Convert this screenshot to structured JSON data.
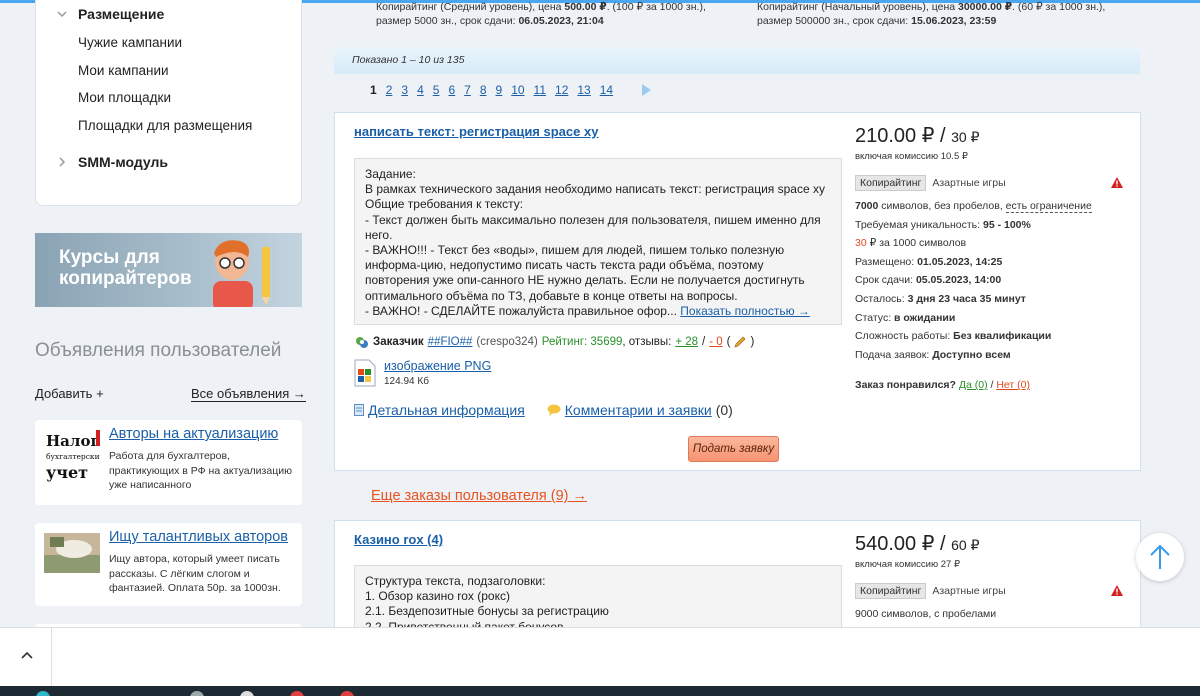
{
  "sidebar": {
    "section_placement": "Размещение",
    "items": [
      "Чужие кампании",
      "Мои кампании",
      "Мои площадки",
      "Площадки для размещения"
    ],
    "section_smm": "SMM-модуль"
  },
  "banner": {
    "text": "Курсы для копирайтеров"
  },
  "ads": {
    "title": "Объявления пользователей",
    "add": "Добавить +",
    "all": "Все объявления →",
    "items": [
      {
        "title": "Авторы на актуализацию",
        "desc": "Работа для бухгалтеров, практикующих в РФ на актуализацию уже написанного",
        "thumb_text": "Налоги бухгалтерский учет"
      },
      {
        "title": "Ищу талантливых авторов",
        "desc": "Ищу автора, который умеет писать рассказы. С лёгким слогом и фантазией. Оплата 50р. за 1000зн."
      }
    ]
  },
  "top_orders": [
    {
      "line1": "Копирайтинг (Средний уровень), цена ",
      "price": "500.00 ₽",
      "rate": ". (100 ₽ за 1000 зн.),",
      "line2": "размер 5000 зн., срок сдачи: ",
      "deadline": "06.05.2023, 21:04"
    },
    {
      "line1": "Копирайтинг (Начальный уровень), цена ",
      "price": "30000.00 ₽",
      "rate": ". (60 ₽ за 1000 зн.),",
      "line2": "размер 500000 зн., срок сдачи: ",
      "deadline": "15.06.2023, 23:59"
    }
  ],
  "shown": "Показано 1 – 10 из 135",
  "pagination": {
    "current": "1",
    "pages": [
      "2",
      "3",
      "4",
      "5",
      "6",
      "7",
      "8",
      "9",
      "10",
      "11",
      "12",
      "13",
      "14"
    ]
  },
  "order1": {
    "title": "написать текст: регистрация space xy",
    "task": "Задание:\nВ рамках технического задания необходимо написать текст: регистрация space xy\nОбщие требования к тексту:\n- Текст должен быть максимально полезен для пользователя, пишем именно для него.\n- ВАЖНО!!! - Текст без «воды», пишем для людей, пишем только полезную информа-цию, недопустимо писать часть текста ради объёма, поэтому повторения уже опи-санного НЕ нужно делать. Если не получается достигнуть оптимального объёма по ТЗ, добавьте в конце ответы на вопросы.\n- ВАЖНО! - СДЕЛАЙТЕ пожалуйста правильное офор...",
    "show_full": "Показать полностью →",
    "price": "210.00 ₽",
    "price_per": "30 ₽",
    "commission": "включая комиссию 10.5 ₽",
    "tag_main": "Копирайтинг",
    "tag_sub": "Азартные игры",
    "chars_value": "7000",
    "chars_text": " символов, без пробелов, ",
    "chars_limit": "есть ограничение",
    "uniqueness_label": "Требуемая уникальность: ",
    "uniqueness_value": "95 - 100%",
    "rate_value": "30",
    "rate_text": " ₽ за 1000 символов",
    "placed_label": "Размещено: ",
    "placed_value": "01.05.2023, 14:25",
    "deadline_label": "Срок сдачи: ",
    "deadline_value": "05.05.2023, 14:00",
    "left_label": "Осталось: ",
    "left_value": "3 дня 23 часа 35 минут",
    "status_label": "Статус: ",
    "status_value": "в ожидании",
    "difficulty_label": "Сложность работы: ",
    "difficulty_value": "Без квалификации",
    "apply_label": "Подача заявок: ",
    "apply_value": "Доступно всем",
    "liked_label": "Заказ понравился?",
    "liked_yes": "Да (0)",
    "liked_no": "Нет (0)",
    "customer_label": "Заказчик",
    "customer_name": "##FIO##",
    "customer_login": "(crespo324)",
    "rating_label": "Рейтинг: 35699",
    "reviews_label": ", отзывы: ",
    "reviews_pos": "+ 28",
    "reviews_neg": "- 0",
    "file_name": "изображение PNG",
    "file_size": "124.94 Кб",
    "details": "Детальная информация",
    "comments": "Комментарии и заявки",
    "comments_count": "(0)",
    "submit": "Подать заявку"
  },
  "more_orders": "Еще заказы пользователя (9) →",
  "order2": {
    "title": "Казино rox (4)",
    "task": "Структура текста, подзаголовки:\n1. Обзор казино rox (рокс)\n2.1. Бездепозитные бонусы за регистрацию\n2.2. Приветственный пакет бонусов",
    "price": "540.00 ₽",
    "price_per": "60 ₽",
    "commission": "включая комиссию 27 ₽",
    "tag_main": "Копирайтинг",
    "tag_sub": "Азартные игры",
    "chars": "9000 символов, с пробелами"
  },
  "colors": {
    "accent": "#1a5fa8",
    "orange": "#e8531f",
    "button": "#f69372",
    "green": "#2a8f2a"
  }
}
